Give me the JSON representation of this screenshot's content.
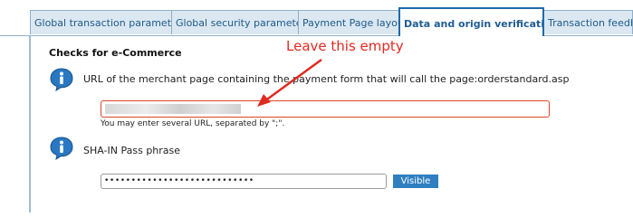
{
  "tabs": [
    {
      "label": "Global transaction parameters",
      "active": false
    },
    {
      "label": "Global security parameters",
      "active": false
    },
    {
      "label": "Payment Page layout",
      "active": false
    },
    {
      "label": "Data and origin verification",
      "active": true
    },
    {
      "label": "Transaction feedback",
      "active": false
    }
  ],
  "section": {
    "title": "Checks for e-Commerce"
  },
  "url_field": {
    "label": "URL of the merchant page containing the payment form that will call the page:orderstandard.asp",
    "hint": "You may enter several URL, separated by \";\"."
  },
  "sha_field": {
    "label": "SHA-IN Pass phrase",
    "value": "••••••••••••••••••••••••••••",
    "button_label": "Visible"
  },
  "annotation": {
    "text": "Leave this empty",
    "color": "#e02a20"
  },
  "colors": {
    "tab_active": "#1f6aa8",
    "tab_bg": "#dbe7f1",
    "button": "#2f7fc0",
    "error_border": "#d9452c"
  },
  "icons": {
    "info": "info-icon"
  }
}
